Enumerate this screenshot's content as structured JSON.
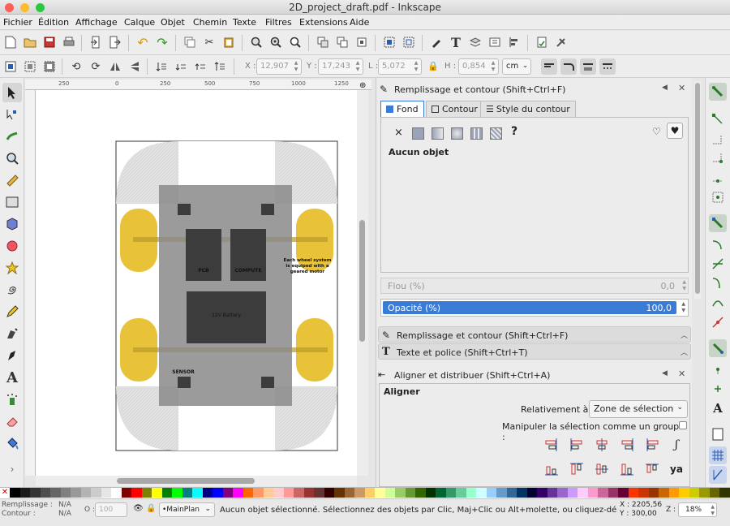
{
  "window": {
    "title": "2D_project_draft.pdf - Inkscape"
  },
  "menu": [
    "Fichier",
    "Édition",
    "Affichage",
    "Calque",
    "Objet",
    "Chemin",
    "Texte",
    "Filtres",
    "Extensions",
    "Aide"
  ],
  "controls": {
    "x_label": "X :",
    "x_value": "12,907",
    "y_label": "Y :",
    "y_value": "17,243",
    "w_label": "L :",
    "w_value": "5,072",
    "h_label": "H :",
    "h_value": "0,854",
    "unit": "cm"
  },
  "ruler": {
    "labels": [
      "250",
      "0",
      "250",
      "500",
      "750",
      "1000",
      "1250"
    ]
  },
  "drawing": {
    "pcb": "PCB",
    "compute": "COMPUTE",
    "battery": "12V Battery",
    "sensor": "SENSOR",
    "wheel_note": [
      "Each wheel system",
      "is equiped with a",
      "geared motor"
    ]
  },
  "fill_stroke": {
    "header": "Remplissage et contour (Shift+Ctrl+F)",
    "tabs": [
      "Fond",
      "Contour",
      "Style du contour"
    ],
    "no_object": "Aucun objet",
    "unset_symbol": "?",
    "blur_label": "Flou (%)",
    "blur_value": "0,0",
    "opacity_label": "Opacité (%)",
    "opacity_value": "100,0"
  },
  "docked": {
    "fill_stroke": "Remplissage et contour (Shift+Ctrl+F)",
    "text_font": "Texte et police (Shift+Ctrl+T)"
  },
  "align": {
    "header": "Aligner et distribuer (Shift+Ctrl+A)",
    "section": "Aligner",
    "relative_label": "Relativement à :",
    "relative_value": "Zone de sélection",
    "group_label": "Manipuler la sélection comme un groupe :"
  },
  "status": {
    "fill_label": "Remplissage :",
    "fill_value": "N/A",
    "stroke_label": "Contour :",
    "stroke_value": "N/A",
    "opacity_label": "O :",
    "opacity_value": "100",
    "layer": "•MainPlan",
    "message": "Aucun objet sélectionné. Sélectionnez des objets par Clic, Maj+Clic ou Alt+molette, ou cliquez-dé",
    "x_readout": "X : 2205,56",
    "y_readout": "Y : 300,00",
    "zoom_label": "Z :",
    "zoom": "18%"
  },
  "colors": {
    "accent": "#3a7bd5",
    "wheel": "#e8c33a",
    "body": "#8a8a8a",
    "dark": "#3c3c3c"
  },
  "palette": [
    "#000000",
    "#1a1a1a",
    "#333333",
    "#4d4d4d",
    "#666666",
    "#808080",
    "#999999",
    "#b3b3b3",
    "#cccccc",
    "#e6e6e6",
    "#ffffff",
    "#800000",
    "#ff0000",
    "#808000",
    "#ffff00",
    "#008000",
    "#00ff00",
    "#008080",
    "#00ffff",
    "#000080",
    "#0000ff",
    "#800080",
    "#ff00ff",
    "#ff6600",
    "#ff9966",
    "#ffcc99",
    "#ffcccc",
    "#ff9999",
    "#cc6666",
    "#993333",
    "#663333",
    "#330000",
    "#663300",
    "#996633",
    "#cc9966",
    "#ffcc66",
    "#ffff99",
    "#ccff99",
    "#99cc66",
    "#669933",
    "#336600",
    "#003300",
    "#006633",
    "#339966",
    "#66cc99",
    "#99ffcc",
    "#ccffff",
    "#99ccff",
    "#6699cc",
    "#336699",
    "#003366",
    "#000033",
    "#330066",
    "#663399",
    "#9966cc",
    "#cc99ff",
    "#ffccff",
    "#ff99cc",
    "#cc6699",
    "#993366",
    "#660033",
    "#ff3300",
    "#cc3300",
    "#993300",
    "#cc6600",
    "#ff9900",
    "#ffcc00",
    "#cccc00",
    "#999900",
    "#666600",
    "#333300"
  ]
}
